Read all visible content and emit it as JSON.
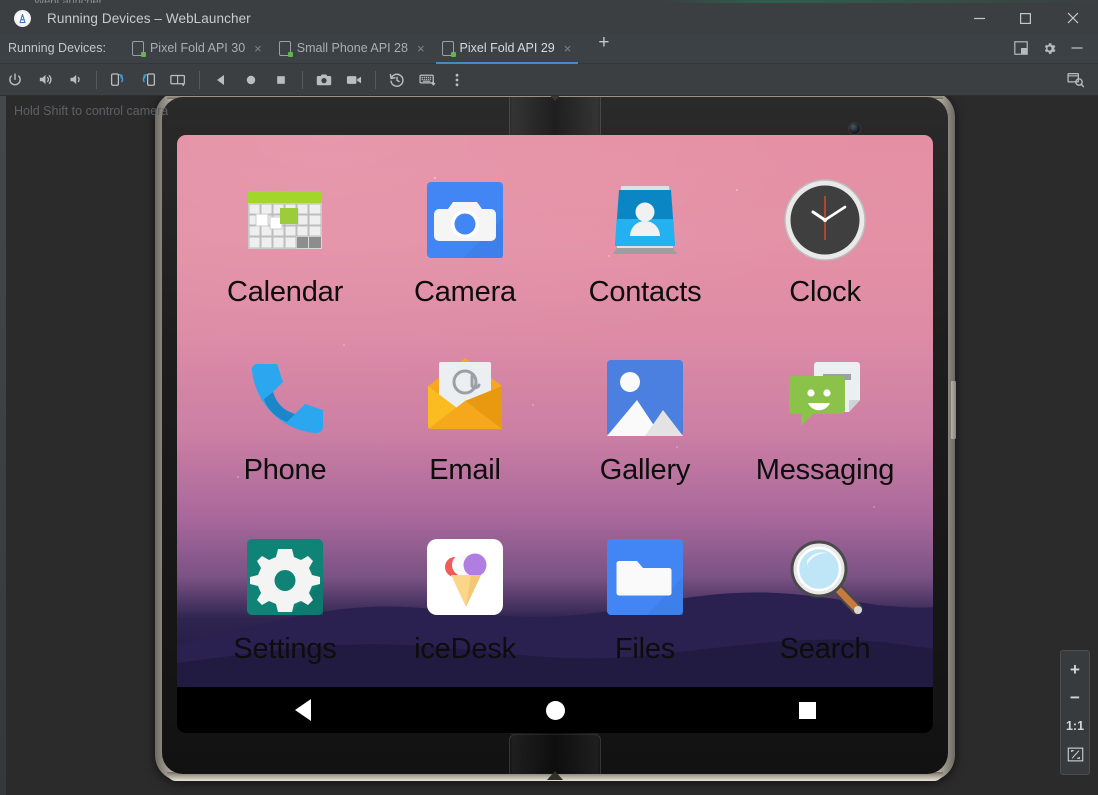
{
  "window": {
    "title": "Running Devices – WebLauncher",
    "app_icon": "android-studio-icon",
    "background_window_title": "WebLauncher",
    "controls": {
      "minimize": "minimize-icon",
      "maximize": "maximize-icon",
      "close": "close-icon"
    }
  },
  "toolwindow": {
    "label": "Running Devices:",
    "tabs": [
      {
        "label": "Pixel Fold API 30",
        "active": false,
        "close": "×",
        "status": "running"
      },
      {
        "label": "Small Phone API 28",
        "active": false,
        "close": "×",
        "status": "running"
      },
      {
        "label": "Pixel Fold API 29",
        "active": true,
        "close": "×",
        "status": "running"
      }
    ],
    "add_tab": "+",
    "right_actions": [
      {
        "name": "split-window-icon",
        "glyph": "◧"
      },
      {
        "name": "settings-gear-icon",
        "glyph": "⚙"
      },
      {
        "name": "hide-tool-window-icon",
        "glyph": "—"
      }
    ]
  },
  "emulator_toolbar": {
    "buttons": [
      {
        "name": "power-button",
        "glyph": "power"
      },
      {
        "name": "volume-up-button",
        "glyph": "volume-up"
      },
      {
        "name": "volume-down-button",
        "glyph": "volume-down"
      },
      {
        "name": "rotate-left-button",
        "glyph": "rotate-left"
      },
      {
        "name": "rotate-right-button",
        "glyph": "rotate-right"
      },
      {
        "name": "fold-button",
        "glyph": "fold"
      },
      {
        "name": "back-button",
        "glyph": "back"
      },
      {
        "name": "home-button",
        "glyph": "home"
      },
      {
        "name": "overview-button",
        "glyph": "overview"
      },
      {
        "name": "screenshot-button",
        "glyph": "camera"
      },
      {
        "name": "screen-record-button",
        "glyph": "video"
      },
      {
        "name": "snapshots-button",
        "glyph": "history"
      },
      {
        "name": "hardware-input-button",
        "glyph": "keyboard"
      },
      {
        "name": "more-actions-button",
        "glyph": "kebab"
      }
    ],
    "right_button": {
      "name": "device-manager-icon",
      "glyph": "windows-search"
    }
  },
  "canvas": {
    "hint": "Hold Shift to control camera"
  },
  "device": {
    "name": "Pixel Fold API 29",
    "form_factor": "foldable",
    "screen": {
      "wallpaper_colors": {
        "sky_top": "#e58fa4",
        "sky_mid": "#cb7fa3",
        "horizon": "#7a5284",
        "mountain": "#241c45",
        "night": "#1d1739"
      },
      "apps": [
        {
          "label": "Calendar",
          "icon": "calendar-icon"
        },
        {
          "label": "Camera",
          "icon": "camera-icon"
        },
        {
          "label": "Contacts",
          "icon": "contacts-icon"
        },
        {
          "label": "Clock",
          "icon": "clock-icon"
        },
        {
          "label": "Phone",
          "icon": "phone-icon"
        },
        {
          "label": "Email",
          "icon": "email-icon"
        },
        {
          "label": "Gallery",
          "icon": "gallery-icon"
        },
        {
          "label": "Messaging",
          "icon": "messaging-icon"
        },
        {
          "label": "Settings",
          "icon": "settings-icon"
        },
        {
          "label": "iceDesk",
          "icon": "icedesk-icon"
        },
        {
          "label": "Files",
          "icon": "files-icon"
        },
        {
          "label": "Search",
          "icon": "search-icon"
        }
      ],
      "navbar": [
        {
          "name": "nav-back-button",
          "glyph": "◀"
        },
        {
          "name": "nav-home-button",
          "glyph": "●"
        },
        {
          "name": "nav-recents-button",
          "glyph": "■"
        }
      ]
    }
  },
  "zoom_controls": {
    "zoom_in": "+",
    "zoom_out": "−",
    "actual_size": "1:1",
    "fit_to_screen": "fit"
  },
  "colors": {
    "accent_tab": "#4a88c7",
    "chrome": "#3c3f41",
    "header": "#3c4146",
    "canvas": "#2b2b2b",
    "status_dot": "#62b54a"
  }
}
